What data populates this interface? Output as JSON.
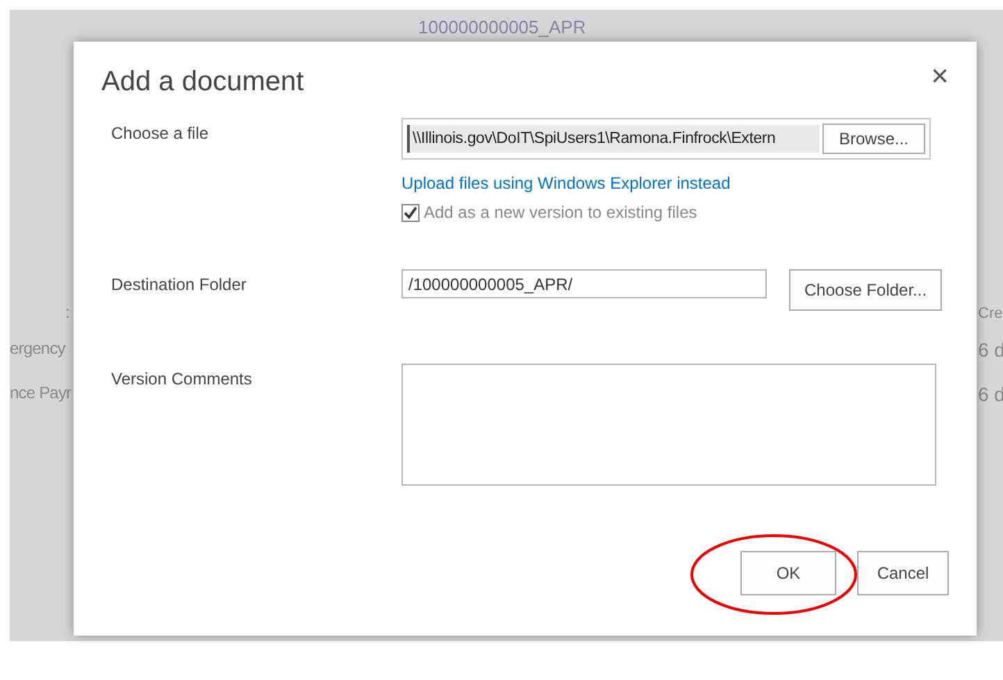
{
  "background_page": {
    "link": "100000000005_APR",
    "left_column": [
      ":",
      "ergency",
      "nce Payr"
    ],
    "right_column": [
      "Cre",
      "6 d",
      "6 d"
    ]
  },
  "dialog": {
    "title": "Add a document",
    "close": "×",
    "file": {
      "label": "Choose a file",
      "value": "\\\\Illinois.gov\\DoIT\\SpiUsers1\\Ramona.Finfrock\\Extern",
      "browse": "Browse..."
    },
    "explorer_link": "Upload files using Windows Explorer instead",
    "new_version": {
      "label": "Add as a new version to existing files",
      "checked": true,
      "disabled": true
    },
    "destination": {
      "label": "Destination Folder",
      "value": "/100000000005_APR/",
      "button": "Choose Folder..."
    },
    "comments": {
      "label": "Version Comments"
    },
    "buttons": [
      {
        "label": "OK",
        "highlighted": true
      },
      {
        "label": "Cancel",
        "highlighted": false
      }
    ]
  }
}
